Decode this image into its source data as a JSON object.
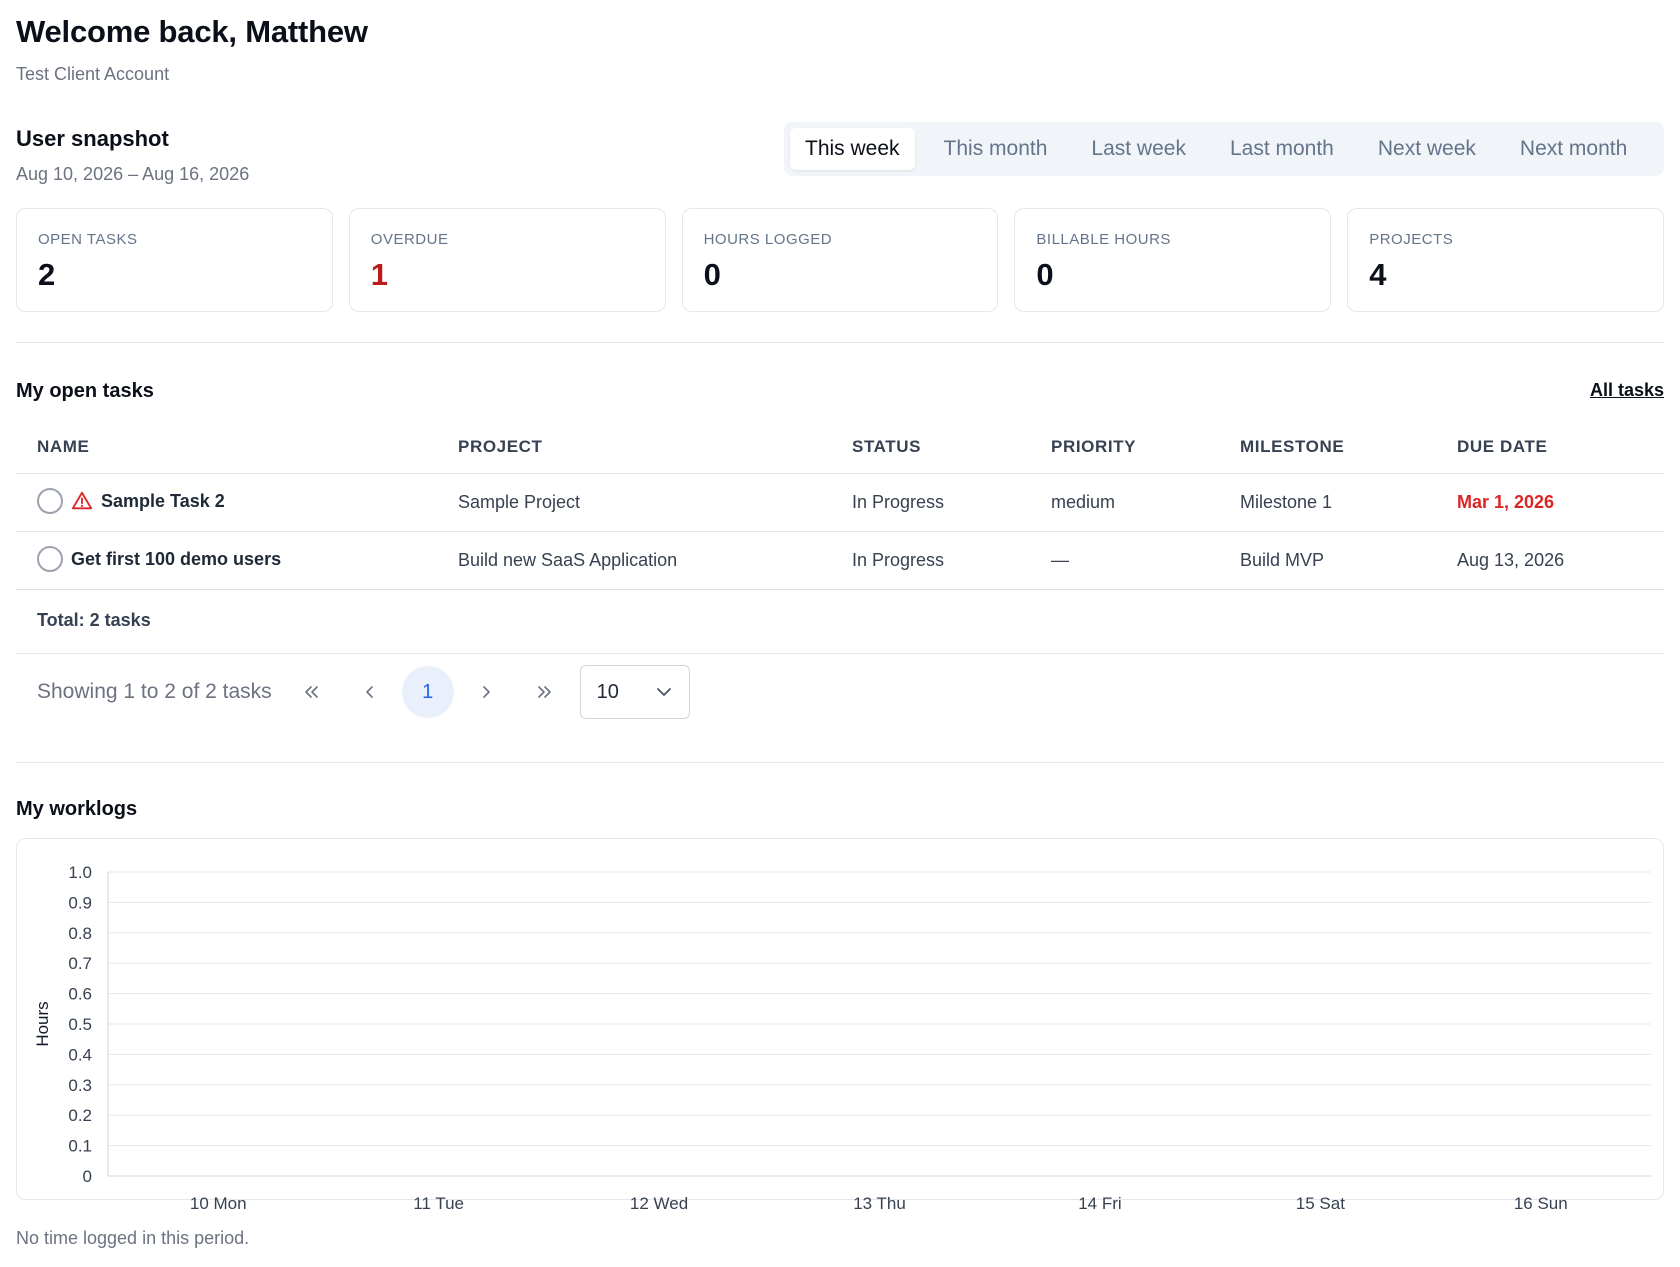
{
  "header": {
    "welcome": "Welcome back, Matthew",
    "account": "Test Client Account"
  },
  "snapshot": {
    "title": "User snapshot",
    "range": "Aug 10, 2026 – Aug 16, 2026",
    "tabs": [
      {
        "label": "This week",
        "active": true
      },
      {
        "label": "This month",
        "active": false
      },
      {
        "label": "Last week",
        "active": false
      },
      {
        "label": "Last month",
        "active": false
      },
      {
        "label": "Next week",
        "active": false
      },
      {
        "label": "Next month",
        "active": false
      }
    ],
    "cards": [
      {
        "label": "OPEN TASKS",
        "value": "2"
      },
      {
        "label": "OVERDUE",
        "value": "1"
      },
      {
        "label": "HOURS LOGGED",
        "value": "0"
      },
      {
        "label": "BILLABLE HOURS",
        "value": "0"
      },
      {
        "label": "PROJECTS",
        "value": "4"
      }
    ]
  },
  "tasks": {
    "title": "My open tasks",
    "all_link": "All tasks",
    "columns": [
      "NAME",
      "PROJECT",
      "STATUS",
      "PRIORITY",
      "MILESTONE",
      "DUE DATE"
    ],
    "rows": [
      {
        "name": "Sample Task 2",
        "project": "Sample Project",
        "status": "In Progress",
        "priority": "medium",
        "milestone": "Milestone 1",
        "due": "Mar 1, 2026",
        "overdue": true
      },
      {
        "name": "Get first 100 demo users",
        "project": "Build new SaaS Application",
        "status": "In Progress",
        "priority": "—",
        "milestone": "Build MVP",
        "due": "Aug 13, 2026",
        "overdue": false
      }
    ],
    "total": "Total: 2 tasks",
    "pager": {
      "showing": "Showing 1 to 2 of 2 tasks",
      "current_page": "1",
      "page_size": "10"
    }
  },
  "worklogs": {
    "title": "My worklogs",
    "empty_note": "No time logged in this period."
  },
  "colors": {
    "danger": "#b91c1c",
    "due_overdue": "#dc2626",
    "accent": "#2563eb",
    "tab_bg": "#f1f4f8",
    "warn_icon": "#dc2626"
  },
  "chart_data": {
    "type": "bar",
    "categories": [
      "10 Mon",
      "11 Tue",
      "12 Wed",
      "13 Thu",
      "14 Fri",
      "15 Sat",
      "16 Sun"
    ],
    "values": [
      0,
      0,
      0,
      0,
      0,
      0,
      0
    ],
    "yticks": [
      "0",
      "0.1",
      "0.2",
      "0.3",
      "0.4",
      "0.5",
      "0.6",
      "0.7",
      "0.8",
      "0.9",
      "1.0"
    ],
    "ylabel": "Hours",
    "ylim": [
      0,
      1
    ],
    "grid": true
  }
}
